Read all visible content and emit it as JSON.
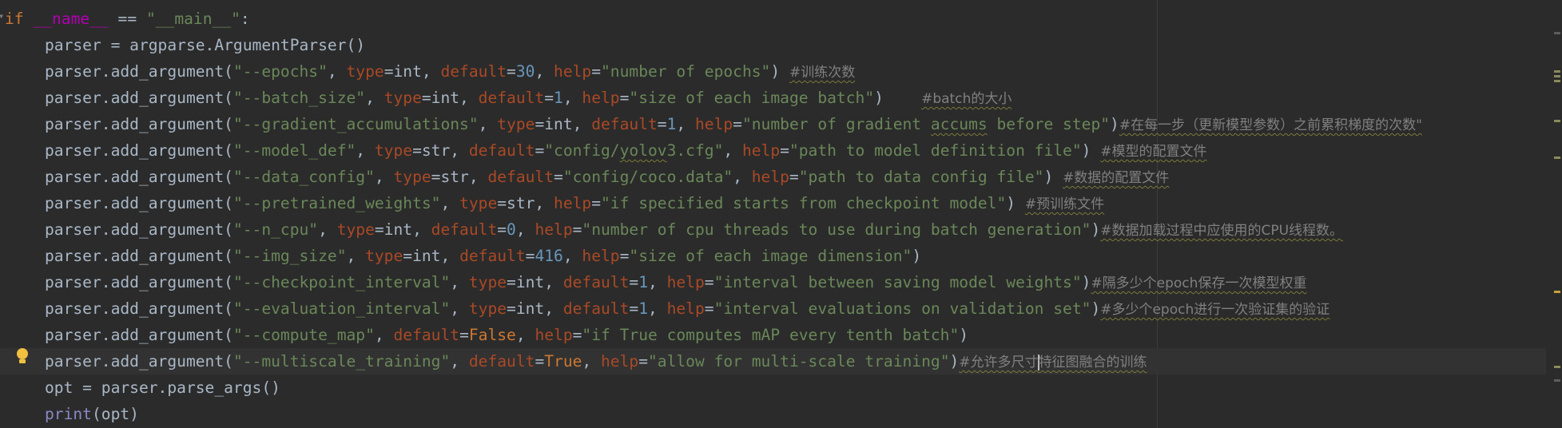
{
  "editor": {
    "colors": {
      "background": "#2b2b2b",
      "keyword": "#cc7832",
      "string": "#6a8759",
      "number": "#6897bb",
      "param": "#aa4926",
      "default_text": "#a9b7c6",
      "comment": "#808080",
      "current_line": "#323232"
    },
    "gutter": {
      "fold_icon": "fold-collapse-icon",
      "bulb_icon": "lightbulb-icon"
    },
    "lines": [
      {
        "t1": "if ",
        "t2": "__name__",
        "t3": " == ",
        "t4": "\"__main__\"",
        "t5": ":"
      },
      {
        "t1": "parser = argparse.ArgumentParser()"
      },
      {
        "t1": "parser.add_argument(",
        "t2": "\"--epochs\"",
        "t3": ", ",
        "t4": "type",
        "t5": "=int, ",
        "t6": "default",
        "t7": "=",
        "t8": "30",
        "t9": ", ",
        "t10": "help",
        "t11": "=",
        "t12": "\"number of epochs\"",
        "t13": ") ",
        "comment": "#训练次数"
      },
      {
        "t1": "parser.add_argument(",
        "t2": "\"--batch_size\"",
        "t3": ", ",
        "t4": "type",
        "t5": "=int, ",
        "t6": "default",
        "t7": "=",
        "t8": "1",
        "t9": ", ",
        "t10": "help",
        "t11": "=",
        "t12": "\"size of each image batch\"",
        "t13": ")    ",
        "comment": "#batch的大小"
      },
      {
        "t1": "parser.add_argument(",
        "t2": "\"--gradient_accumulations\"",
        "t3": ", ",
        "t4": "type",
        "t5": "=int, ",
        "t6": "default",
        "t7": "=",
        "t8": "1",
        "t9": ", ",
        "t10": "help",
        "t11": "=",
        "t12a": "\"number of gradient ",
        "t12b": "accums",
        "t12c": " before step\"",
        "t13": ")",
        "comment": "#在每一步（更新模型参数）之前累积梯度的次数\""
      },
      {
        "t1": "parser.add_argument(",
        "t2": "\"--model_def\"",
        "t3": ", ",
        "t4": "type",
        "t5": "=str, ",
        "t6": "default",
        "t7": "=",
        "t8a": "\"config/",
        "t8b": "yolov",
        "t8c": "3.cfg\"",
        "t9": ", ",
        "t10": "help",
        "t11": "=",
        "t12": "\"path to model definition file\"",
        "t13": ") ",
        "comment": "#模型的配置文件"
      },
      {
        "t1": "parser.add_argument(",
        "t2": "\"--data_config\"",
        "t3": ", ",
        "t4": "type",
        "t5": "=str, ",
        "t6": "default",
        "t7": "=",
        "t8": "\"config/coco.data\"",
        "t9": ", ",
        "t10": "help",
        "t11": "=",
        "t12": "\"path to data config file\"",
        "t13": ") ",
        "comment": "#数据的配置文件"
      },
      {
        "t1": "parser.add_argument(",
        "t2": "\"--pretrained_weights\"",
        "t3": ", ",
        "t4": "type",
        "t5": "=str, ",
        "t10": "help",
        "t11": "=",
        "t12": "\"if specified starts from checkpoint model\"",
        "t13": ") ",
        "comment": "#预训练文件"
      },
      {
        "t1": "parser.add_argument(",
        "t2": "\"--n_cpu\"",
        "t3": ", ",
        "t4": "type",
        "t5": "=int, ",
        "t6": "default",
        "t7": "=",
        "t8": "0",
        "t9": ", ",
        "t10": "help",
        "t11": "=",
        "t12": "\"number of cpu threads to use during batch generation\"",
        "t13": ")",
        "comment": "#数据加载过程中应使用的CPU线程数。"
      },
      {
        "t1": "parser.add_argument(",
        "t2": "\"--img_size\"",
        "t3": ", ",
        "t4": "type",
        "t5": "=int, ",
        "t6": "default",
        "t7": "=",
        "t8": "416",
        "t9": ", ",
        "t10": "help",
        "t11": "=",
        "t12": "\"size of each image dimension\"",
        "t13": ")"
      },
      {
        "t1": "parser.add_argument(",
        "t2": "\"--checkpoint_interval\"",
        "t3": ", ",
        "t4": "type",
        "t5": "=int, ",
        "t6": "default",
        "t7": "=",
        "t8": "1",
        "t9": ", ",
        "t10": "help",
        "t11": "=",
        "t12": "\"interval between saving model weights\"",
        "t13": ")",
        "comment": "#隔多少个epoch保存一次模型权重"
      },
      {
        "t1": "parser.add_argument(",
        "t2": "\"--evaluation_interval\"",
        "t3": ", ",
        "t4": "type",
        "t5": "=int, ",
        "t6": "default",
        "t7": "=",
        "t8": "1",
        "t9": ", ",
        "t10": "help",
        "t11": "=",
        "t12": "\"interval evaluations on validation set\"",
        "t13": ")",
        "comment": "#多少个epoch进行一次验证集的验证"
      },
      {
        "t1": "parser.add_argument(",
        "t2": "\"--compute_map\"",
        "t3": ", ",
        "t6": "default",
        "t7": "=",
        "t8kw": "False",
        "t9": ", ",
        "t10": "help",
        "t11": "=",
        "t12": "\"if True computes mAP every tenth batch\"",
        "t13": ")"
      },
      {
        "t1": "parser.add_argument(",
        "t2": "\"--multiscale_training\"",
        "t3": ", ",
        "t6": "default",
        "t7": "=",
        "t8kw": "True",
        "t9": ", ",
        "t10": "help",
        "t11": "=",
        "t12": "\"allow for multi-scale training\"",
        "t13": ")",
        "comment_a": "#允许多尺寸",
        "comment_b": "特征图融合的训练"
      },
      {
        "t1": "opt = parser.parse_args()"
      },
      {
        "t1a": "print",
        "t1b": "(opt)"
      }
    ]
  }
}
